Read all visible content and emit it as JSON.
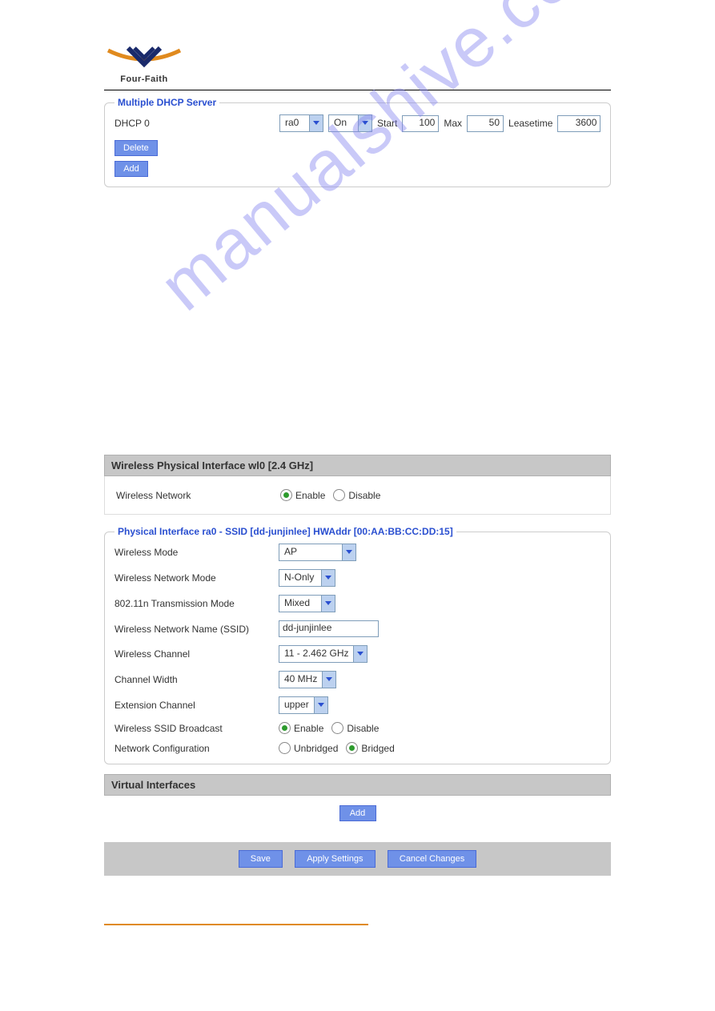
{
  "brand": {
    "name": "Four-Faith"
  },
  "watermark": "manualshive.com",
  "dhcp": {
    "legend": "Multiple DHCP Server",
    "name_label": "DHCP 0",
    "iface": "ra0",
    "state": "On",
    "start_label": "Start",
    "start": "100",
    "max_label": "Max",
    "max": "50",
    "lease_label": "Leasetime",
    "lease": "3600",
    "delete_btn": "Delete",
    "add_btn": "Add"
  },
  "wl0": {
    "bar": "Wireless Physical Interface wl0 [2.4 GHz]",
    "net_label": "Wireless Network",
    "enable": "Enable",
    "disable": "Disable"
  },
  "phys": {
    "legend": "Physical Interface ra0 - SSID [dd-junjinlee] HWAddr [00:AA:BB:CC:DD:15]",
    "rows": {
      "mode_label": "Wireless Mode",
      "mode_val": "AP",
      "netmode_label": "Wireless Network Mode",
      "netmode_val": "N-Only",
      "txmode_label": "802.11n Transmission Mode",
      "txmode_val": "Mixed",
      "ssid_label": "Wireless Network Name (SSID)",
      "ssid_val": "dd-junjinlee",
      "chan_label": "Wireless Channel",
      "chan_val": "11 - 2.462 GHz",
      "width_label": "Channel Width",
      "width_val": "40 MHz",
      "ext_label": "Extension Channel",
      "ext_val": "upper",
      "bcast_label": "Wireless SSID Broadcast",
      "bcast_enable": "Enable",
      "bcast_disable": "Disable",
      "netcfg_label": "Network Configuration",
      "netcfg_unbridged": "Unbridged",
      "netcfg_bridged": "Bridged"
    }
  },
  "virtual": {
    "bar": "Virtual Interfaces",
    "add_btn": "Add"
  },
  "footer": {
    "save": "Save",
    "apply": "Apply Settings",
    "cancel": "Cancel Changes"
  }
}
